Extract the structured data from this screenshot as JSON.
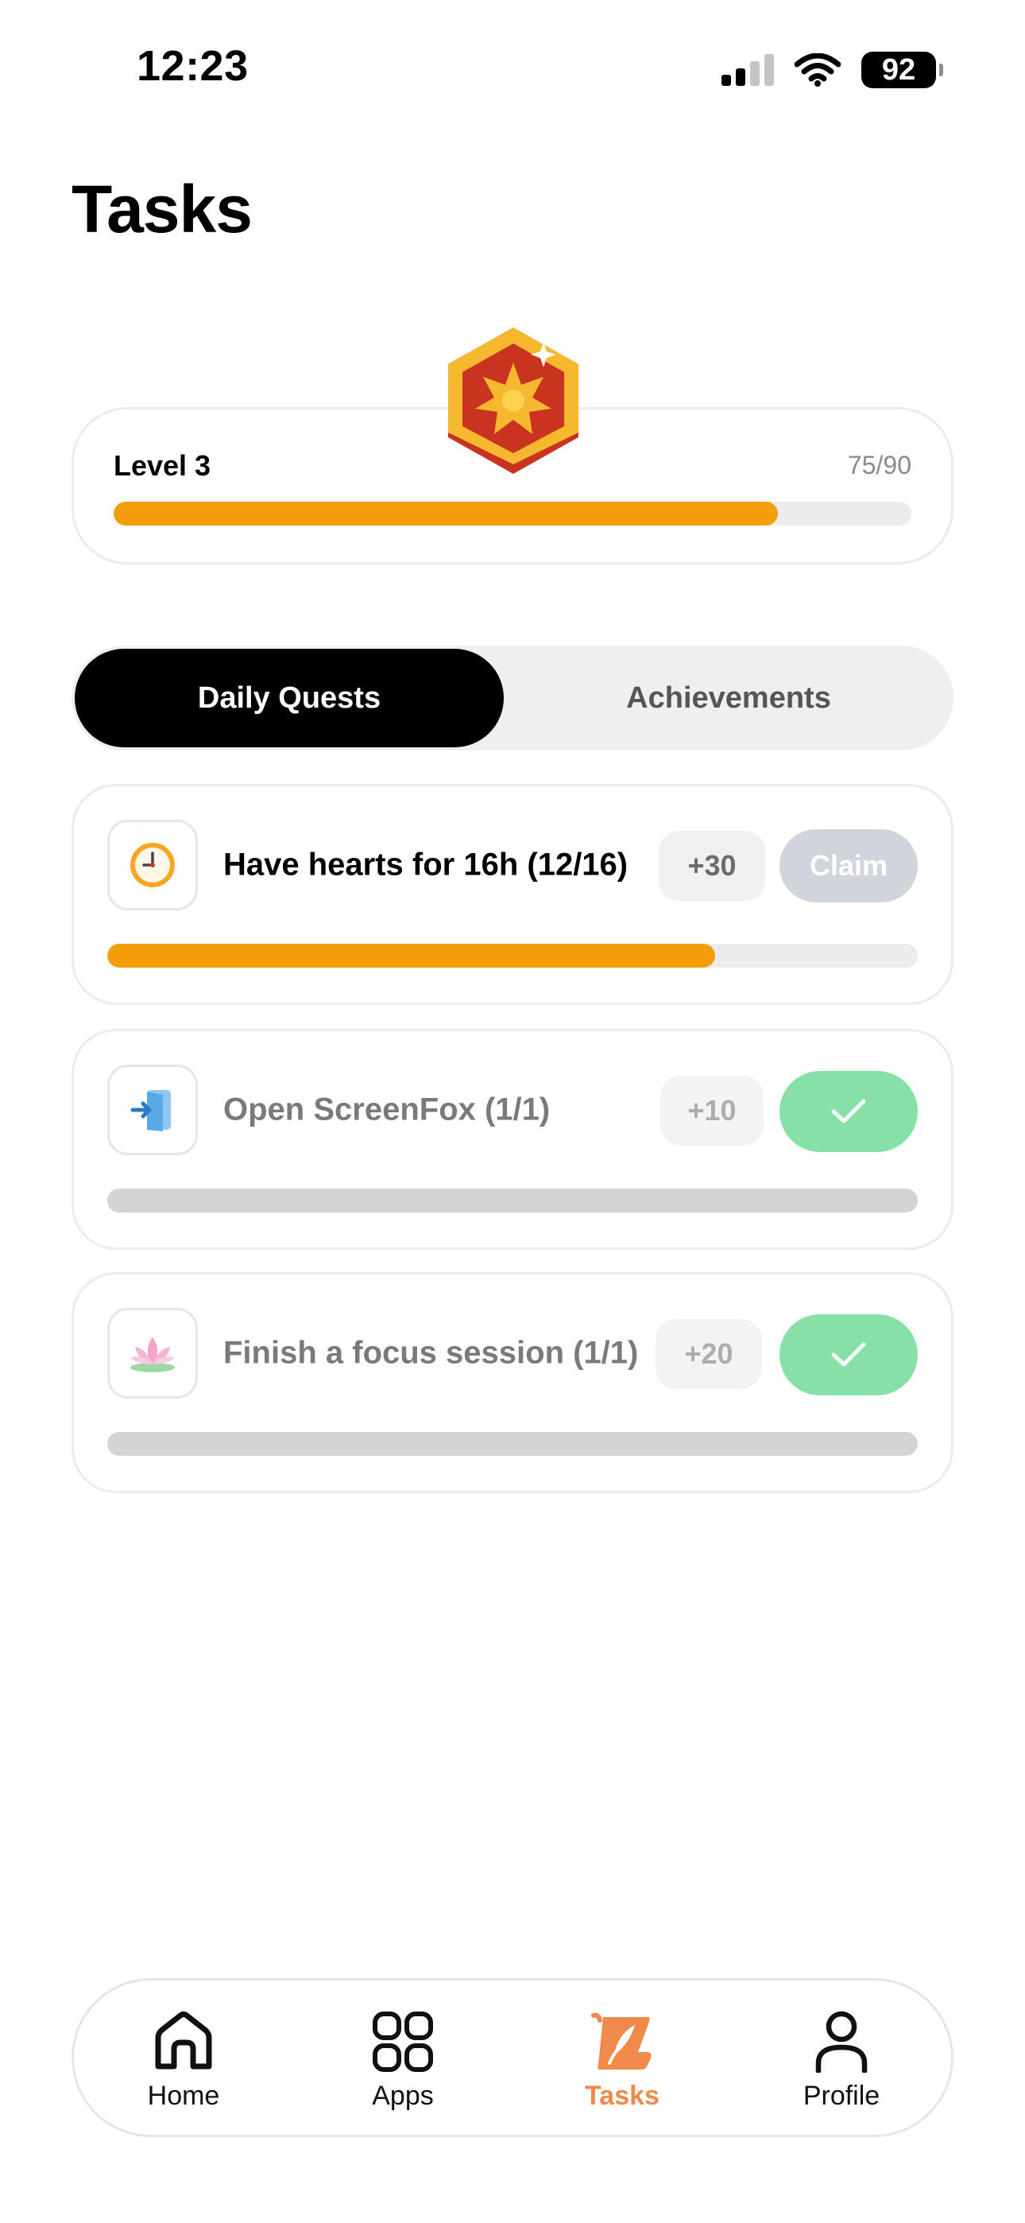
{
  "status_bar": {
    "time": "12:23",
    "battery": "92"
  },
  "page": {
    "title": "Tasks"
  },
  "level": {
    "label": "Level 3",
    "count": "75/90",
    "progress": 0.833
  },
  "segmented": {
    "active": "Daily Quests",
    "inactive": "Achievements"
  },
  "quests": [
    {
      "title": "Have hearts for 16h (12/16)",
      "points": "+30",
      "action": "Claim",
      "progress": 0.75,
      "completed": false,
      "icon": "clock-icon"
    },
    {
      "title": "Open ScreenFox (1/1)",
      "points": "+10",
      "action": "check",
      "progress": 1,
      "completed": true,
      "icon": "enter-door-icon"
    },
    {
      "title": "Finish a focus session (1/1)",
      "points": "+20",
      "action": "check",
      "progress": 1,
      "completed": true,
      "icon": "lotus-icon"
    }
  ],
  "tabbar": {
    "items": [
      {
        "label": "Home",
        "icon": "home-icon"
      },
      {
        "label": "Apps",
        "icon": "apps-grid-icon"
      },
      {
        "label": "Tasks",
        "icon": "tasks-leaf-icon",
        "active": true
      },
      {
        "label": "Profile",
        "icon": "profile-icon"
      }
    ]
  },
  "colors": {
    "accent": "#f59e0b",
    "tab_active": "#f08a4b",
    "done": "#86e0a8",
    "badge_red": "#c8341f",
    "badge_gold": "#f5b82e"
  }
}
